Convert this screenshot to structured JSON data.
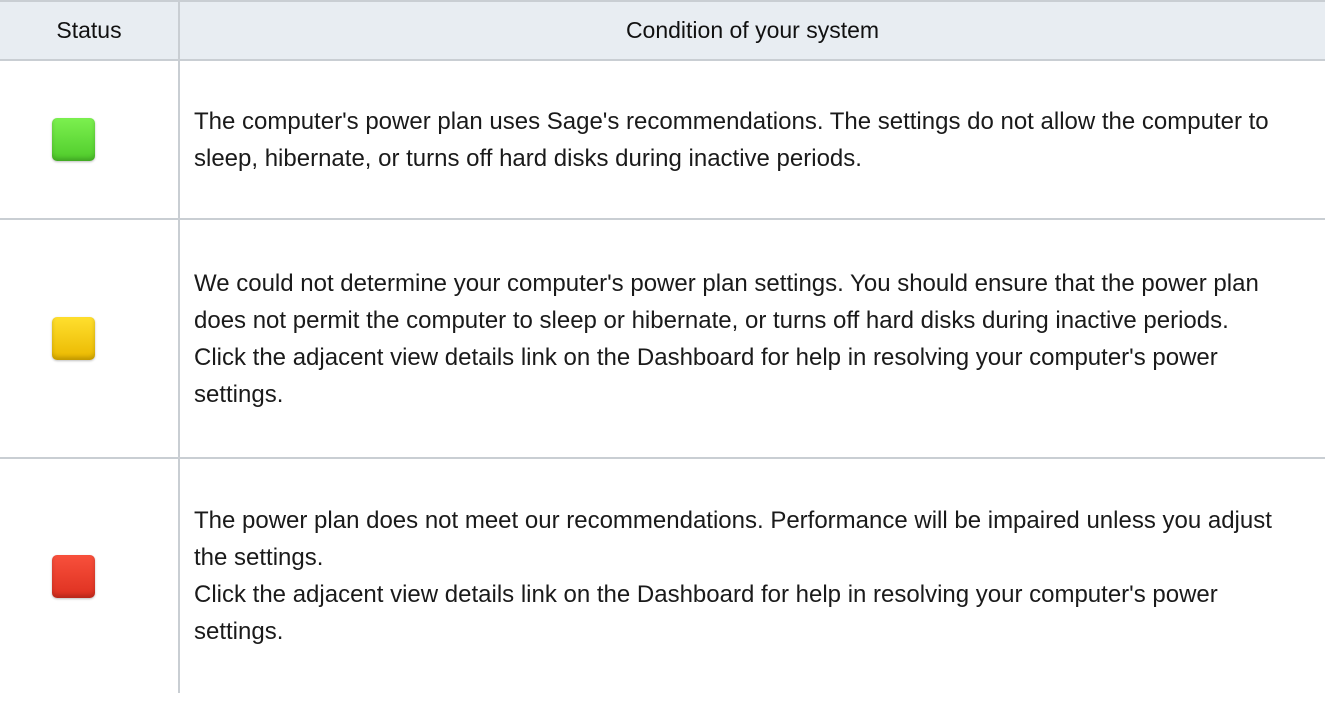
{
  "table": {
    "headers": {
      "status": "Status",
      "condition": "Condition of your system"
    },
    "rows": [
      {
        "status_color": "#5cd638",
        "status_icon": "green-status-square-icon",
        "paragraphs": [
          "The computer's power plan uses Sage's recommendations. The settings do not allow the computer to sleep, hibernate, or turns off hard disks during inactive periods."
        ]
      },
      {
        "status_color": "#f2c800",
        "status_icon": "yellow-status-square-icon",
        "paragraphs": [
          "We could not determine your computer's power plan settings. You should ensure that the power plan does not permit the computer to sleep or hibernate, or turns off hard disks during inactive periods.",
          "Click the adjacent view details link on the Dashboard for help in resolving your computer's power settings."
        ]
      },
      {
        "status_color": "#e83a2a",
        "status_icon": "red-status-square-icon",
        "paragraphs": [
          "The power plan does not meet our recommendations. Performance will be impaired unless you adjust the settings.",
          "Click the adjacent view details link on the Dashboard for help in resolving your computer's power settings."
        ]
      }
    ]
  }
}
